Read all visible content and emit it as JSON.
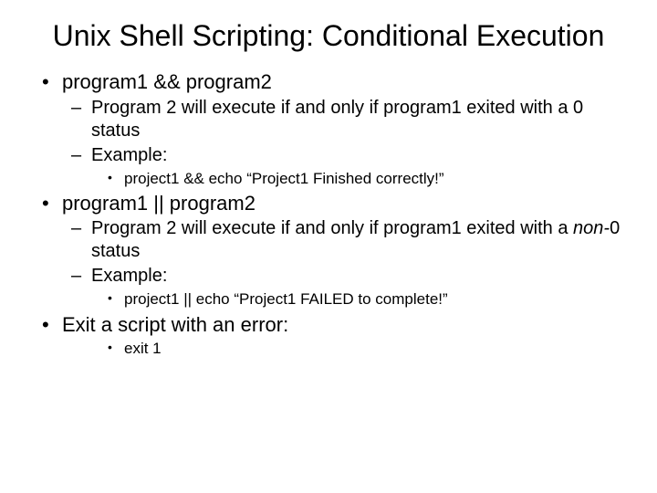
{
  "title": "Unix Shell Scripting: Conditional Execution",
  "b1": {
    "head": "program1 && program2",
    "s1": "Program 2 will execute if and only if program1 exited with a 0 status",
    "s2": "Example:",
    "ex": "project1 && echo “Project1 Finished correctly!”"
  },
  "b2": {
    "head": "program1 || program2",
    "s1a": "Program 2 will execute if and only if program1 exited with a ",
    "s1b": "non-",
    "s1c": "0 status",
    "s2": "Example:",
    "ex": "project1 || echo “Project1 FAILED to complete!”"
  },
  "b3": {
    "head": "Exit a script with an error:",
    "ex": "exit 1"
  }
}
